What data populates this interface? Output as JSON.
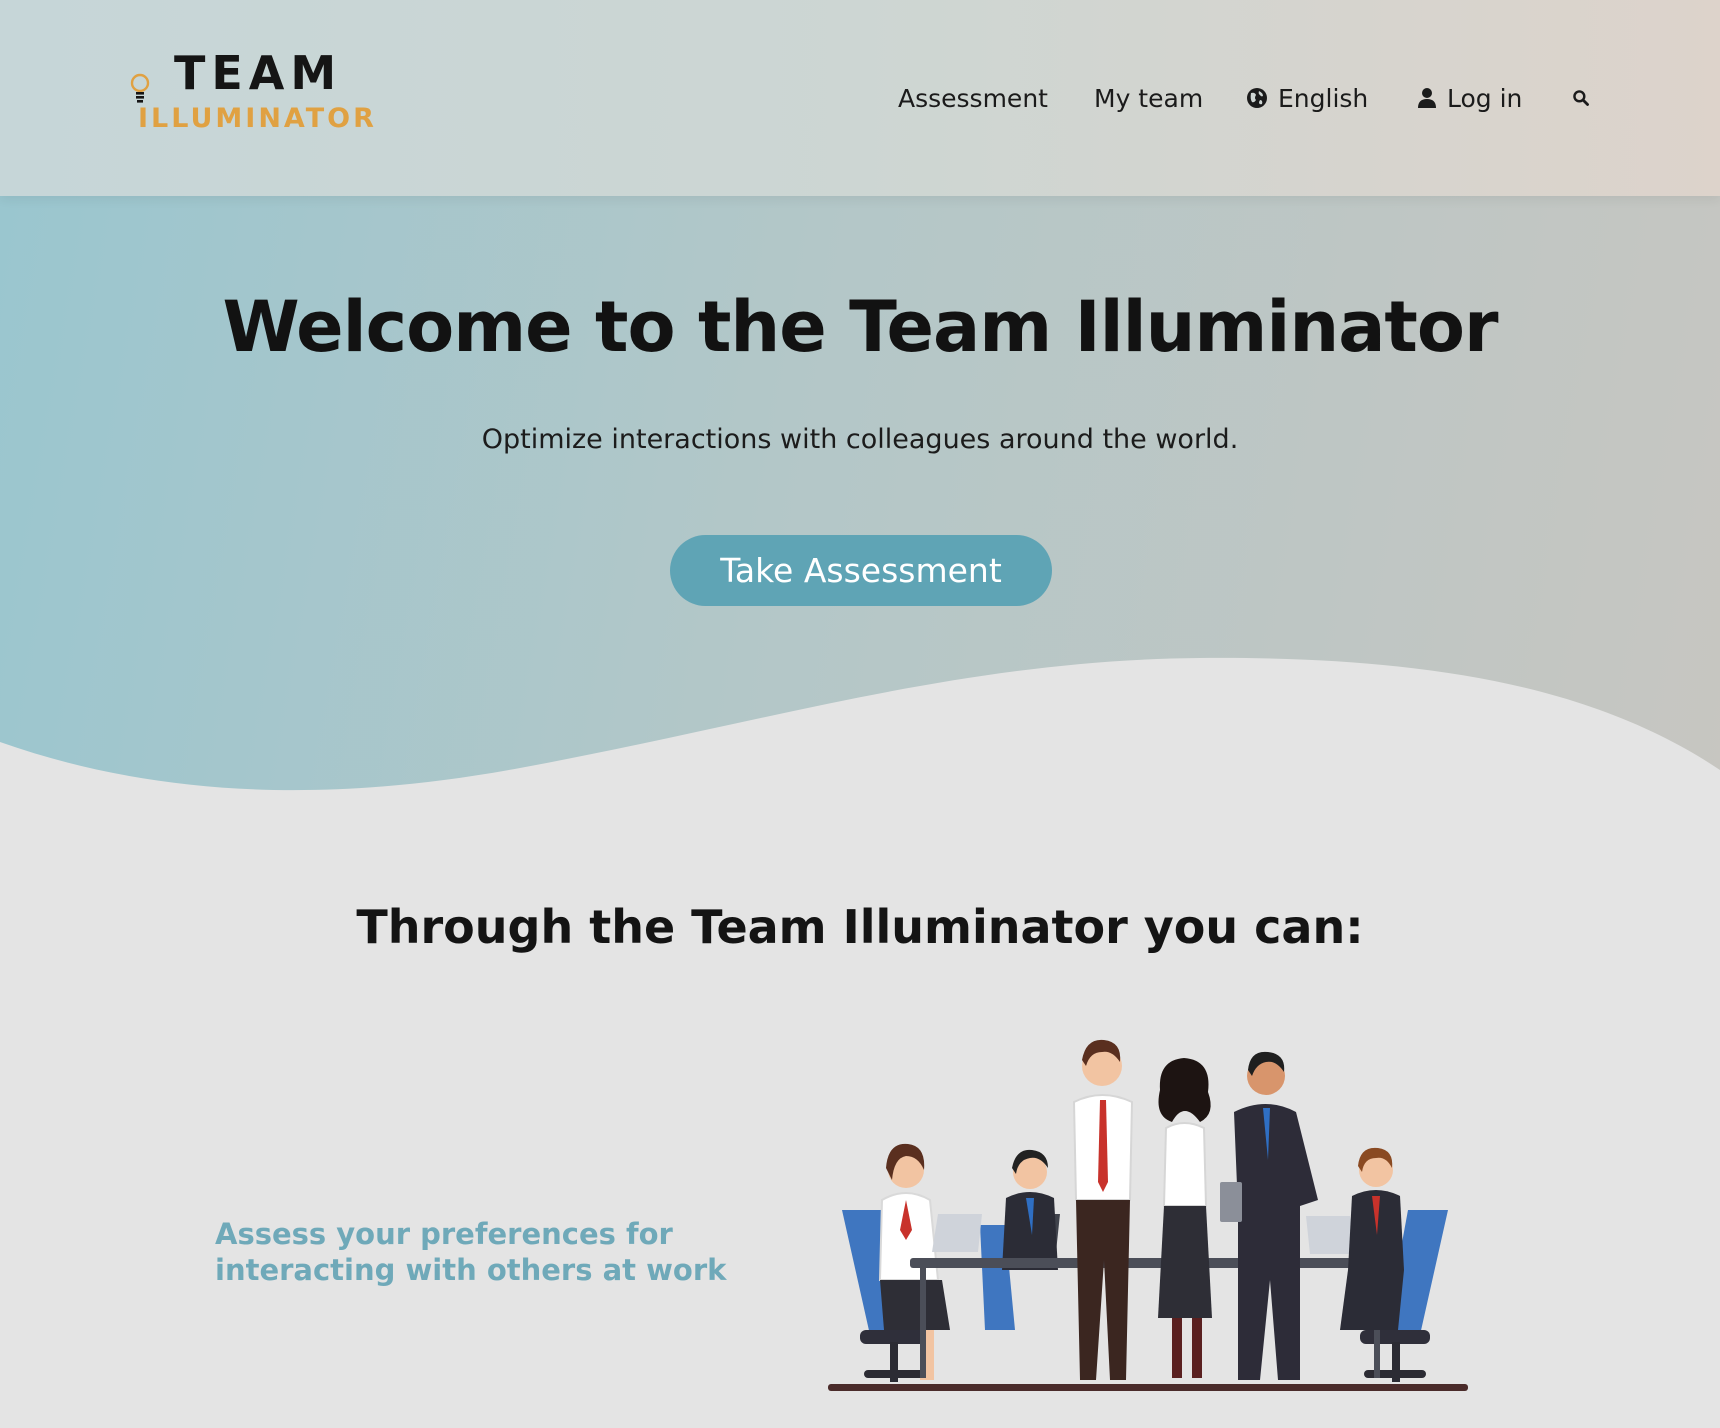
{
  "header": {
    "logo": {
      "line1": "TEAM",
      "line2": "ILLUMINATOR"
    },
    "nav": {
      "assessment": "Assessment",
      "my_team": "My team",
      "language": "English",
      "login": "Log in"
    },
    "icons": {
      "language": "globe-icon",
      "login": "user-icon",
      "search": "search-icon"
    }
  },
  "hero": {
    "title": "Welcome to the Team Illuminator",
    "subtitle": "Optimize interactions with colleagues around the world.",
    "cta_label": "Take Assessment"
  },
  "features": {
    "heading": "Through the Team Illuminator you can:",
    "items": [
      {
        "text": "Assess your preferences for interacting with others at work"
      }
    ]
  },
  "colors": {
    "accent": "#5fa4b5",
    "logo_orange": "#e0a142",
    "feature_text": "#6fa9b9",
    "background": "#e4e4e4"
  }
}
